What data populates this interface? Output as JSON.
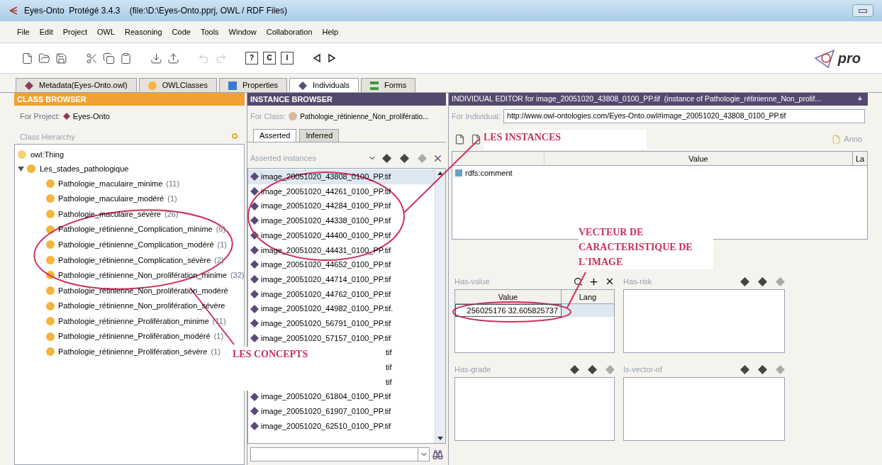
{
  "window": {
    "title": "Eyes-Onto  Protégé 3.4.3    (file:\\D:\\Eyes-Onto.pprj, OWL / RDF Files)",
    "logo_text": "pro"
  },
  "menu": [
    "File",
    "Edit",
    "Project",
    "OWL",
    "Reasoning",
    "Code",
    "Tools",
    "Window",
    "Collaboration",
    "Help"
  ],
  "toolbar": [
    {
      "kind": "new"
    },
    {
      "kind": "open"
    },
    {
      "kind": "save"
    },
    {
      "kind": "sep"
    },
    {
      "kind": "cut"
    },
    {
      "kind": "copy"
    },
    {
      "kind": "paste"
    },
    {
      "kind": "sep"
    },
    {
      "kind": "import"
    },
    {
      "kind": "export"
    },
    {
      "kind": "sep"
    },
    {
      "kind": "undo"
    },
    {
      "kind": "redo"
    },
    {
      "kind": "sep"
    },
    {
      "kind": "boxed",
      "glyph": "?"
    },
    {
      "kind": "boxed",
      "glyph": "C"
    },
    {
      "kind": "boxed",
      "glyph": "I"
    },
    {
      "kind": "sep"
    },
    {
      "kind": "back"
    },
    {
      "kind": "forward"
    }
  ],
  "tabs": [
    {
      "label": "Metadata(Eyes-Onto.owl)",
      "kind": "metadata",
      "selected": false
    },
    {
      "label": "OWLClasses",
      "kind": "classes",
      "selected": false
    },
    {
      "label": "Properties",
      "kind": "properties",
      "selected": false
    },
    {
      "label": "Individuals",
      "kind": "individuals",
      "selected": true
    },
    {
      "label": "Forms",
      "kind": "forms",
      "selected": false
    }
  ],
  "class_browser": {
    "title": "CLASS BROWSER",
    "project_label": "For Project:",
    "project": "Eyes-Onto",
    "hierarchy_label": "Class Hierarchy",
    "tree": [
      {
        "label": "owl:Thing",
        "expanded": false
      },
      {
        "label": "Les_stades_pathologique",
        "expanded": true,
        "children": [
          {
            "label": "Pathologie_maculaire_minime",
            "count": "(11)"
          },
          {
            "label": "Pathologie_maculaire_modéré",
            "count": "(1)"
          },
          {
            "label": "Pathologie_maculaire_sévère",
            "count": "(26)"
          },
          {
            "label": "Pathologie_rétinienne_Complication_minime",
            "count": "(6)"
          },
          {
            "label": "Pathologie_rétinienne_Complication_modéré",
            "count": "(1)"
          },
          {
            "label": "Pathologie_rétinienne_Complication_sévère",
            "count": "(2)"
          },
          {
            "label": "Pathologie_rétinienne_Non_prolifération_minime",
            "count": "(32)"
          },
          {
            "label": "Pathologie_rétinienne_Non_prolifération_modéré"
          },
          {
            "label": "Pathologie_rétinienne_Non_prolifération_sévère"
          },
          {
            "label": "Pathologie_rétinienne_Prolifération_minime",
            "count": "(11)"
          },
          {
            "label": "Pathologie_rétinienne_Prolifération_modéré",
            "count": "(1)"
          },
          {
            "label": "Pathologie_rétinienne_Prolifération_sévère",
            "count": "(1)"
          }
        ]
      }
    ]
  },
  "instance_browser": {
    "title": "INSTANCE BROWSER",
    "class_label": "For Class:",
    "class": "Pathologie_rétinienne_Non_prolifératio...",
    "subtabs": [
      {
        "label": "Asserted",
        "selected": true
      },
      {
        "label": "Inferred",
        "selected": false
      }
    ],
    "list_label": "Asserted instances",
    "instances": [
      {
        "label": "image_20051020_43808_0100_PP.tif",
        "selected": true,
        "kind": "full"
      },
      {
        "label": "image_20051020_44261_0100_PP.tif",
        "selected": false,
        "kind": "full"
      },
      {
        "label": "image_20051020_44284_0100_PP.tif",
        "selected": false,
        "kind": "full"
      },
      {
        "label": "image_20051020_44338_0100_PP.tif",
        "selected": false,
        "kind": "full"
      },
      {
        "label": "image_20051020_44400_0100_PP.tif",
        "selected": false,
        "kind": "full"
      },
      {
        "label": "image_20051020_44431_0100_PP.tif",
        "selected": false,
        "kind": "full"
      },
      {
        "label": "image_20051020_44652_0100_PP.tif",
        "selected": false,
        "kind": "full"
      },
      {
        "label": "image_20051020_44714_0100_PP.tif",
        "selected": false,
        "kind": "full"
      },
      {
        "label": "image_20051020_44762_0100_PP.tif",
        "selected": false,
        "kind": "full"
      },
      {
        "label": "image_20051020_44982_0100_PP.tif.",
        "selected": false,
        "kind": "full"
      },
      {
        "label": "image_20051020_56791_0100_PP.tif",
        "selected": false,
        "kind": "full"
      },
      {
        "label": "image_20051020_57157_0100_PP.tif",
        "selected": false,
        "kind": "full"
      },
      {
        "label": "tif",
        "selected": false,
        "kind": "covered"
      },
      {
        "label": "tif",
        "selected": false,
        "kind": "covered"
      },
      {
        "label": "tif",
        "selected": false,
        "kind": "covered"
      },
      {
        "label": "image_20051020_61804_0100_PP.tif",
        "selected": false,
        "kind": "full"
      },
      {
        "label": "image_20051020_61907_0100_PP.tif",
        "selected": false,
        "kind": "full"
      },
      {
        "label": "image_20051020_62510_0100_PP.tif",
        "selected": false,
        "kind": "full"
      }
    ]
  },
  "individual_editor": {
    "title": "INDIVIDUAL EDITOR for image_20051020_43808_0100_PP.tif  (instance of Pathologie_rétinienne_Non_prolif...",
    "add": "+",
    "individual_label": "For Individual:",
    "individual": "http://www.owl-ontologies.com/Eyes-Onto.owl#image_20051020_43808_0100_PP.tif",
    "annotations_button": "Anno",
    "columns": [
      "Value",
      "La"
    ],
    "rows": [
      {
        "property": "rdfs:comment"
      }
    ],
    "widgets": [
      {
        "label": "Has-value",
        "kind": "table",
        "columns": [
          "Value",
          "Lang"
        ],
        "values": [
          "256025176 32.605825737"
        ]
      },
      {
        "label": "Has-risk",
        "kind": "list"
      },
      {
        "label": "Has-grade",
        "kind": "list"
      },
      {
        "label": "Is-vector-of",
        "kind": "list"
      }
    ]
  },
  "annotations": [
    {
      "text": "LES INSTANCES"
    },
    {
      "text": "LES CONCEPTS"
    },
    {
      "text": "VECTEUR DE CARACTERISTIQUE DE L'IMAGE"
    }
  ]
}
